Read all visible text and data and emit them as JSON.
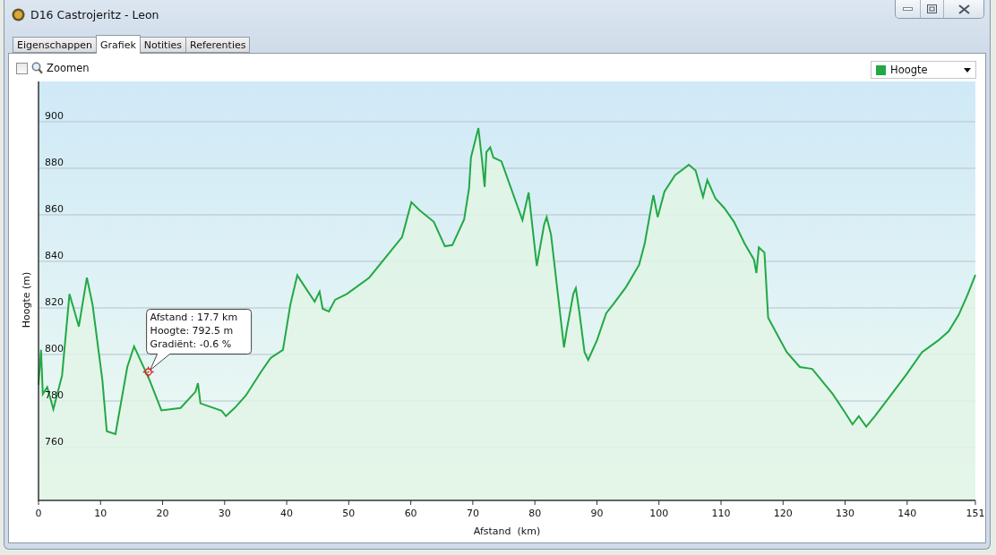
{
  "window": {
    "title": "D16 Castrojeritz - Leon"
  },
  "tabs": [
    {
      "label": "Eigenschappen",
      "selected": false
    },
    {
      "label": "Grafiek",
      "selected": true
    },
    {
      "label": "Notities",
      "selected": false
    },
    {
      "label": "Referenties",
      "selected": false
    }
  ],
  "toolbar": {
    "zoom": {
      "label": "Zoomen",
      "checked": false
    }
  },
  "chart": {
    "chart_data": {
      "type": "area",
      "xlabel": "Afstand  (km)",
      "ylabel": "Hoogte (m)",
      "x": [
        0,
        0.4,
        0.7,
        1.4,
        2.4,
        3.8,
        5,
        6.5,
        7.8,
        8.7,
        10.3,
        11,
        12.4,
        14.3,
        15.4,
        17.9,
        19.8,
        22.9,
        25.3,
        25.7,
        26.1,
        29.5,
        30.2,
        31.6,
        33.4,
        35.9,
        37.4,
        39.4,
        40.6,
        41.7,
        44.5,
        45.3,
        45.8,
        46.8,
        47.8,
        49.7,
        53.3,
        58.6,
        60.1,
        61.4,
        63.7,
        65.5,
        66.7,
        68.6,
        69.4,
        69.7,
        70.9,
        71.5,
        71.9,
        72.2,
        72.8,
        73.3,
        74.6,
        78,
        79,
        80.3,
        81.5,
        81.9,
        82.6,
        84.7,
        85.1,
        86.2,
        86.6,
        87.2,
        88,
        88.6,
        90,
        91.5,
        92.6,
        94.7,
        96.8,
        97.7,
        99.1,
        99.8,
        100.9,
        102.6,
        104.8,
        105.9,
        107.1,
        107.8,
        109.1,
        110.5,
        112.1,
        113.8,
        115.3,
        115.7,
        116.1,
        117,
        117.6,
        120.6,
        122.7,
        124.7,
        128,
        130.1,
        131.2,
        132.2,
        133.4,
        134.8,
        137,
        139.9,
        142.4,
        145,
        146.7,
        148.3,
        149.7,
        151
      ],
      "series": [
        {
          "name": "Hoogte",
          "color": "#22a845",
          "values": [
            786.9,
            802,
            783,
            786,
            776.5,
            791,
            826,
            812,
            833,
            821.5,
            789,
            767,
            765.8,
            794.6,
            803.5,
            789,
            776,
            777,
            784,
            787.7,
            779,
            775.8,
            773.5,
            777,
            782.3,
            792.7,
            798.5,
            802,
            821.5,
            834,
            822.7,
            827,
            819.6,
            818.5,
            823.5,
            826,
            833,
            850.4,
            865.4,
            862,
            857,
            846.5,
            847,
            858,
            871.5,
            884.6,
            897.3,
            883,
            872,
            887,
            889,
            884.6,
            883,
            857.7,
            869.6,
            838,
            856,
            859,
            851.5,
            803,
            810,
            826,
            828.5,
            817.7,
            801,
            797.7,
            806,
            817.7,
            821.5,
            829,
            838.5,
            847.7,
            868.5,
            859,
            870,
            877,
            881.5,
            879,
            867.7,
            875,
            867,
            863,
            857,
            847.7,
            840.8,
            835,
            846,
            843.8,
            815.8,
            801,
            794.6,
            793.8,
            783,
            774.6,
            770,
            773.5,
            769,
            773.5,
            781.2,
            791.5,
            801,
            806,
            810,
            817,
            825.4,
            834.2
          ]
        }
      ],
      "xlim": [
        0,
        151
      ],
      "ylim": [
        737.3,
        917.3
      ],
      "xticks": [
        0,
        10,
        20,
        30,
        40,
        50,
        60,
        70,
        80,
        90,
        100,
        110,
        120,
        130,
        140,
        151
      ],
      "yticks": [
        760,
        780,
        800,
        820,
        840,
        860,
        880,
        900
      ],
      "grid": true
    },
    "tooltip": {
      "lines": [
        "Afstand : 17.7 km",
        "Hoogte: 792.5 m",
        "Gradiënt: -0.6 %"
      ]
    }
  }
}
